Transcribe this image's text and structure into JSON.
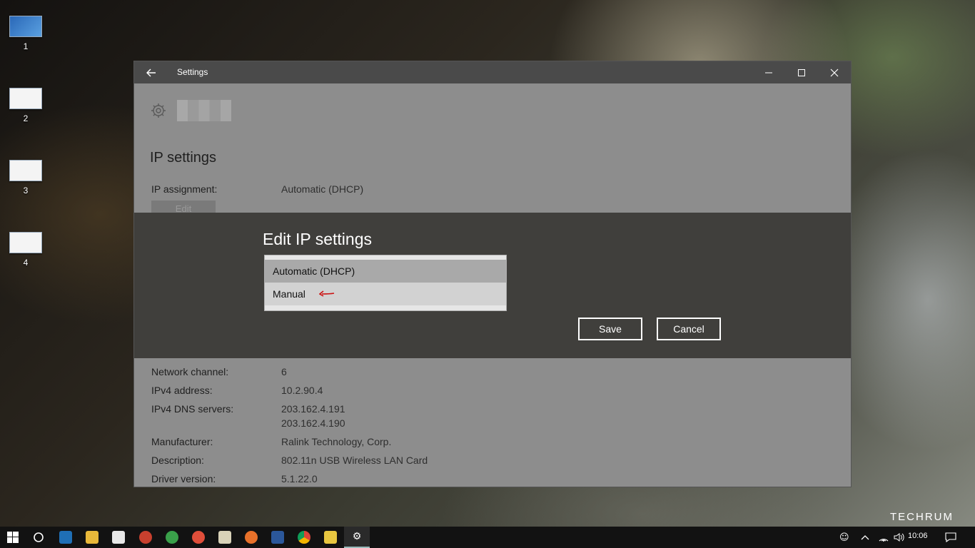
{
  "desktop": {
    "icons": [
      {
        "label": "1"
      },
      {
        "label": "2"
      },
      {
        "label": "3"
      },
      {
        "label": "4"
      }
    ],
    "watermark": "TECHRUM"
  },
  "window": {
    "title": "Settings",
    "back_icon": "arrow-left-icon",
    "controls": [
      "minimize-icon",
      "maximize-icon",
      "close-icon"
    ],
    "section_title": "IP settings",
    "ip_assignment_label": "IP assignment:",
    "ip_assignment_value": "Automatic (DHCP)",
    "edit_label": "Edit",
    "properties": [
      {
        "label": "Network channel:",
        "value": "6"
      },
      {
        "label": "IPv4 address:",
        "value": "10.2.90.4"
      },
      {
        "label": "IPv4 DNS servers:",
        "value": "203.162.4.191",
        "value2": "203.162.4.190"
      },
      {
        "label": "Manufacturer:",
        "value": "Ralink Technology, Corp."
      },
      {
        "label": "Description:",
        "value": "802.11n USB Wireless LAN Card"
      },
      {
        "label": "Driver version:",
        "value": "5.1.22.0"
      }
    ]
  },
  "dialog": {
    "title": "Edit IP settings",
    "options": [
      "Automatic (DHCP)",
      "Manual"
    ],
    "selected": "Automatic (DHCP)",
    "save_label": "Save",
    "cancel_label": "Cancel",
    "arrow_color": "#cc1111"
  },
  "taskbar": {
    "clock": "10:06",
    "apps": [
      "windows-start-icon",
      "cortana-icon",
      "go-tv-icon",
      "file-explorer-icon",
      "mail-icon",
      "app-red-icon",
      "app-green-icon",
      "app-spiral-icon",
      "paint-icon",
      "firefox-icon",
      "word-icon",
      "chrome-icon",
      "media-player-icon",
      "settings-icon"
    ],
    "tray": [
      "people-icon",
      "chevron-up-icon",
      "wifi-icon",
      "volume-icon",
      "notification-icon"
    ]
  }
}
